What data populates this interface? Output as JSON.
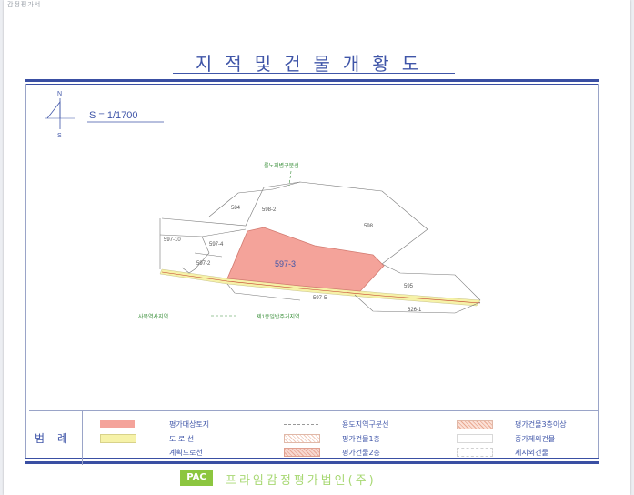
{
  "header_note": "감정평가서",
  "title": "지적및건물개황도",
  "north": {
    "n": "N",
    "s": "S"
  },
  "scale": "S = 1/1700",
  "map_labels": {
    "road_top": "를노지변구분선",
    "lot_584": "584",
    "lot_598_2": "598-2",
    "lot_598": "598",
    "lot_597_10": "597-10",
    "lot_597_4": "597-4",
    "lot_597_2": "597-2",
    "lot_597_3": "597-3",
    "lot_595": "595",
    "lot_597_5": "597-5",
    "lot_626_1": "626-1",
    "station": "사북역사지역",
    "zone_note": "제1종일반주거지역"
  },
  "legend": {
    "heading": "범례",
    "items": [
      {
        "label": "평가대상토지",
        "swatch": "subject"
      },
      {
        "label": "도  로  선",
        "swatch": "road"
      },
      {
        "label": "계획도로선",
        "swatch": "plan"
      },
      {
        "label": "용도지역구분선",
        "swatch": "zoneline"
      },
      {
        "label": "평가건물1층",
        "swatch": "bldg1"
      },
      {
        "label": "평가건물2층",
        "swatch": "bldg2"
      },
      {
        "label": "평가건물3층이상",
        "swatch": "bldg3"
      },
      {
        "label": "증가제외건물",
        "swatch": "excl"
      },
      {
        "label": "제시외건물",
        "swatch": "extra"
      }
    ]
  },
  "footer": {
    "badge": "PAC",
    "company": "프라임감정평가법인(주)"
  },
  "colors": {
    "accent": "#3f55a8",
    "subject": "#f4a39a",
    "road": "#f6f2a8",
    "plan": "#c0392b",
    "green": "#3a8f3a",
    "footer_green": "#8cc63f"
  }
}
